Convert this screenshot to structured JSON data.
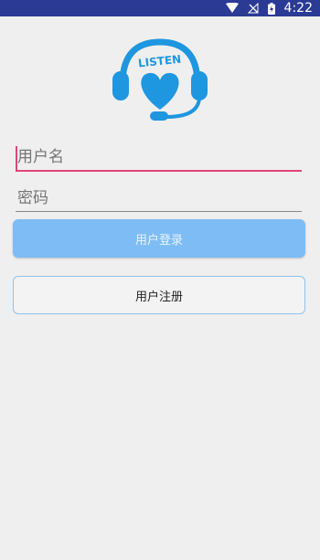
{
  "status_bar": {
    "time": "4:22",
    "icons": [
      "wifi-icon",
      "no-signal-icon",
      "battery-charging-icon"
    ],
    "background": "#2b3a94"
  },
  "logo": {
    "text": "LISTEN",
    "icon": "headset-heart-icon",
    "color": "#1e96e0"
  },
  "form": {
    "username_placeholder": "用户名",
    "username_value": "",
    "password_placeholder": "密码",
    "password_value": "",
    "focus_color": "#e0457a"
  },
  "buttons": {
    "login_label": "用户登录",
    "register_label": "用户注册",
    "login_color": "#7ebcf5"
  }
}
